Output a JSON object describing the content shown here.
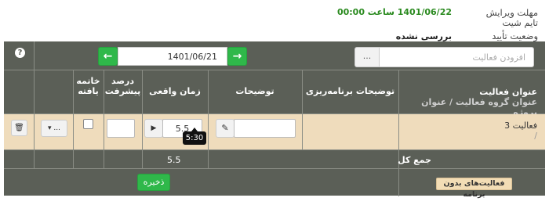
{
  "timesheet_info": {
    "deadline_label": "مهلت ویرایش تایم شیت",
    "deadline_value": "1401/06/22 ساعت 00:00",
    "status_label": "وضعیت تأیید",
    "status_value": "بررسی نشده"
  },
  "toolbar": {
    "help_label": "?",
    "prev_label": "←",
    "next_label": "→",
    "date_value": "1401/06/21",
    "add_dots_label": "...",
    "add_placeholder": "افزودن فعالیت"
  },
  "table": {
    "headers": {
      "title": "عنوان فعالیت",
      "title_sub": "عنوان گروه فعالیت  / عنوان پروژه",
      "planning_description": "توضیحات برنامه‌ریزی",
      "description": "توضیحات",
      "actual_time": "زمان واقعی",
      "progress_percent": "درصد پیشرفت",
      "completed": "خاتمه یافته"
    },
    "rows": [
      {
        "activity_name": "فعالیت 3",
        "activity_sub": "/",
        "actual_time": "5.5",
        "menu_label": "...",
        "tooltip": "5:30"
      }
    ],
    "total_label": "جمع کل",
    "total_value": "5.5"
  },
  "footer": {
    "save_label": "ذخیره",
    "unplanned_label": "فعالیت‌های بدون برنامه"
  },
  "colors": {
    "panel": "#5b5f57",
    "row_highlight": "#efdcbc",
    "accent_green": "#2fb84a",
    "deadline_text": "#2a8a1f"
  }
}
